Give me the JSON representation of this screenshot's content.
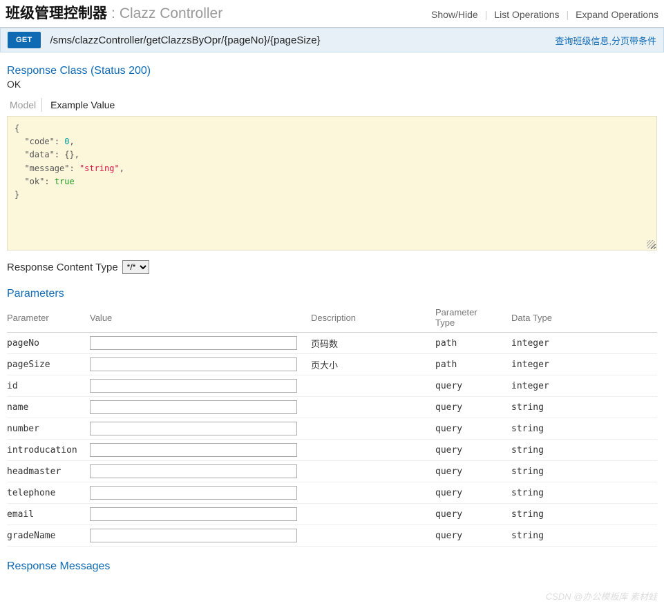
{
  "header": {
    "title_cn": "班级管理控制器",
    "title_sep": " : ",
    "title_en": "Clazz Controller",
    "actions": {
      "show_hide": "Show/Hide",
      "list_ops": "List Operations",
      "expand_ops": "Expand Operations"
    }
  },
  "operation": {
    "method": "GET",
    "path": "/sms/clazzController/getClazzsByOpr/{pageNo}/{pageSize}",
    "summary": "查询班级信息,分页带条件"
  },
  "response": {
    "title": "Response Class (Status 200)",
    "status_text": "OK",
    "tabs": {
      "model": "Model",
      "example": "Example Value"
    },
    "example_json": {
      "line1_open": "{",
      "code_key": "\"code\"",
      "code_val": "0",
      "data_key": "\"data\"",
      "data_val": "{}",
      "message_key": "\"message\"",
      "message_val": "\"string\"",
      "ok_key": "\"ok\"",
      "ok_val": "true",
      "line_close": "}"
    },
    "content_type_label": "Response Content Type",
    "content_type_value": "*/*"
  },
  "parameters": {
    "title": "Parameters",
    "headers": {
      "param": "Parameter",
      "value": "Value",
      "desc": "Description",
      "ptype": "Parameter Type",
      "dtype": "Data Type"
    },
    "rows": [
      {
        "name": "pageNo",
        "desc": "页码数",
        "ptype": "path",
        "dtype": "integer"
      },
      {
        "name": "pageSize",
        "desc": "页大小",
        "ptype": "path",
        "dtype": "integer"
      },
      {
        "name": "id",
        "desc": "",
        "ptype": "query",
        "dtype": "integer"
      },
      {
        "name": "name",
        "desc": "",
        "ptype": "query",
        "dtype": "string"
      },
      {
        "name": "number",
        "desc": "",
        "ptype": "query",
        "dtype": "string"
      },
      {
        "name": "introducation",
        "desc": "",
        "ptype": "query",
        "dtype": "string"
      },
      {
        "name": "headmaster",
        "desc": "",
        "ptype": "query",
        "dtype": "string"
      },
      {
        "name": "telephone",
        "desc": "",
        "ptype": "query",
        "dtype": "string"
      },
      {
        "name": "email",
        "desc": "",
        "ptype": "query",
        "dtype": "string"
      },
      {
        "name": "gradeName",
        "desc": "",
        "ptype": "query",
        "dtype": "string"
      }
    ]
  },
  "response_messages": {
    "title": "Response Messages"
  },
  "watermark": "CSDN @办公模板库 素材蛙"
}
